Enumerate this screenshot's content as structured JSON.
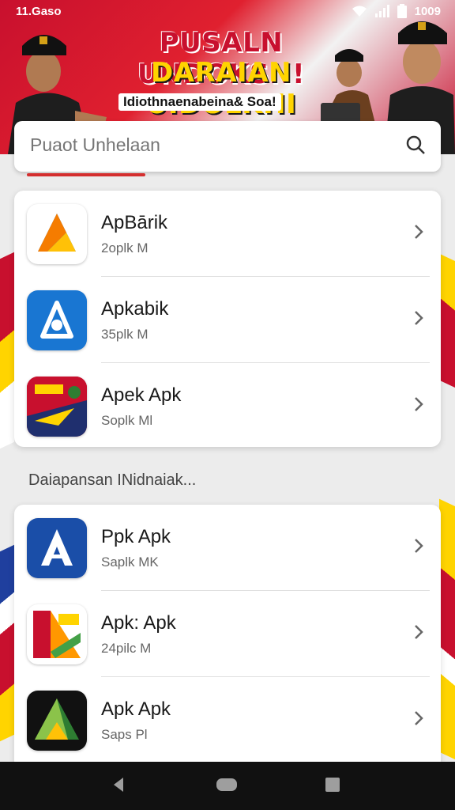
{
  "status_bar": {
    "time": "11.Gaso",
    "battery_text": "1009"
  },
  "banner": {
    "title_line1": "PUSALN UNDOKSN!",
    "title_line2": "DARAIAN UIDOLKHI",
    "subtitle": "Idiothnaenabeina& Soa!"
  },
  "search": {
    "placeholder": "Puaot Unhelaan"
  },
  "apps_top": [
    {
      "name": "ApBārik",
      "size": "2oplk M",
      "icon": "apbarik-app-icon"
    },
    {
      "name": "Apkabik",
      "size": "35plk M",
      "icon": "apkabik-app-icon"
    },
    {
      "name": "Apek Apk",
      "size": "Soplk Ml",
      "icon": "apek-apk-app-icon"
    }
  ],
  "section_header": "Daiapansan INidnaiak...",
  "apps_bottom": [
    {
      "name": "Ppk Apk",
      "size": "Saplk MK",
      "icon": "ppk-apk-app-icon"
    },
    {
      "name": "Apk: Apk",
      "size": "24pilc M",
      "icon": "apk-apk-app-icon"
    },
    {
      "name": "Apk Apk",
      "size": "Saps Pl",
      "icon": "apk-apk-green-app-icon"
    }
  ],
  "colors": {
    "accent_red": "#d42f2f",
    "flag_red": "#c8102e",
    "flag_yellow": "#ffd400",
    "nav_bg": "#111111"
  }
}
